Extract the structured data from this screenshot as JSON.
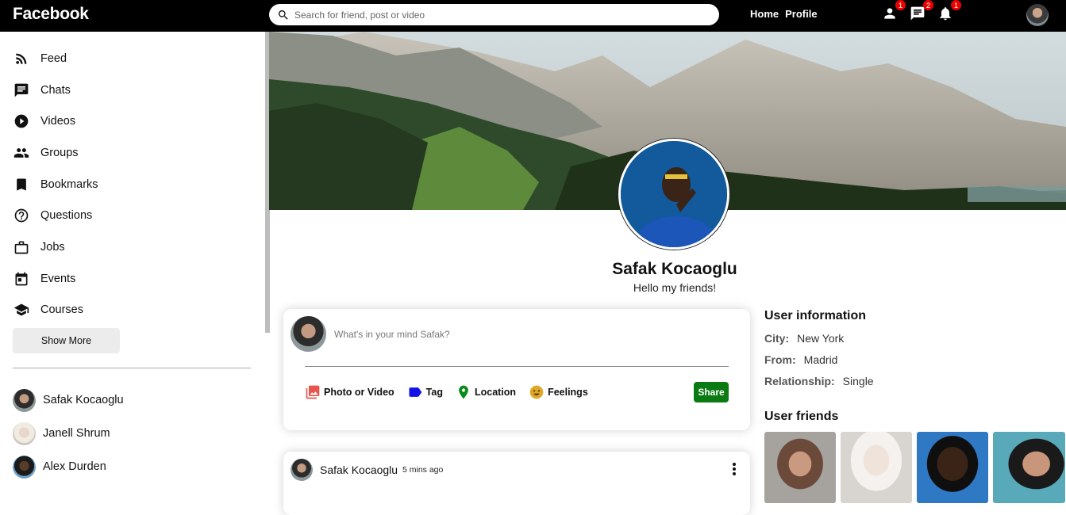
{
  "topbar": {
    "logo": "Facebook",
    "search_placeholder": "Search for friend, post or video",
    "links": [
      "Home",
      "Profile"
    ],
    "badges": {
      "friends": "1",
      "chats": "2",
      "notifications": "1"
    }
  },
  "sidebar": {
    "items": [
      {
        "label": "Feed",
        "icon": "rss-feed-icon"
      },
      {
        "label": "Chats",
        "icon": "chat-icon"
      },
      {
        "label": "Videos",
        "icon": "play-circle-icon"
      },
      {
        "label": "Groups",
        "icon": "group-icon"
      },
      {
        "label": "Bookmarks",
        "icon": "bookmark-icon"
      },
      {
        "label": "Questions",
        "icon": "help-circle-icon"
      },
      {
        "label": "Jobs",
        "icon": "briefcase-icon"
      },
      {
        "label": "Events",
        "icon": "calendar-icon"
      },
      {
        "label": "Courses",
        "icon": "school-icon"
      }
    ],
    "show_more": "Show More",
    "friends": [
      "Safak Kocaoglu",
      "Janell Shrum",
      "Alex Durden"
    ]
  },
  "profile": {
    "name": "Safak Kocaoglu",
    "description": "Hello my friends!"
  },
  "share": {
    "placeholder": "What's in your mind Safak?",
    "options": [
      "Photo or Video",
      "Tag",
      "Location",
      "Feelings"
    ],
    "button": "Share",
    "button_color": "#0a7a12"
  },
  "post": {
    "author": "Safak Kocaoglu",
    "time": "5 mins ago"
  },
  "user_info": {
    "title": "User information",
    "rows": [
      {
        "key": "City:",
        "value": "New York"
      },
      {
        "key": "From:",
        "value": "Madrid"
      },
      {
        "key": "Relationship:",
        "value": "Single"
      }
    ],
    "friends_title": "User friends"
  }
}
